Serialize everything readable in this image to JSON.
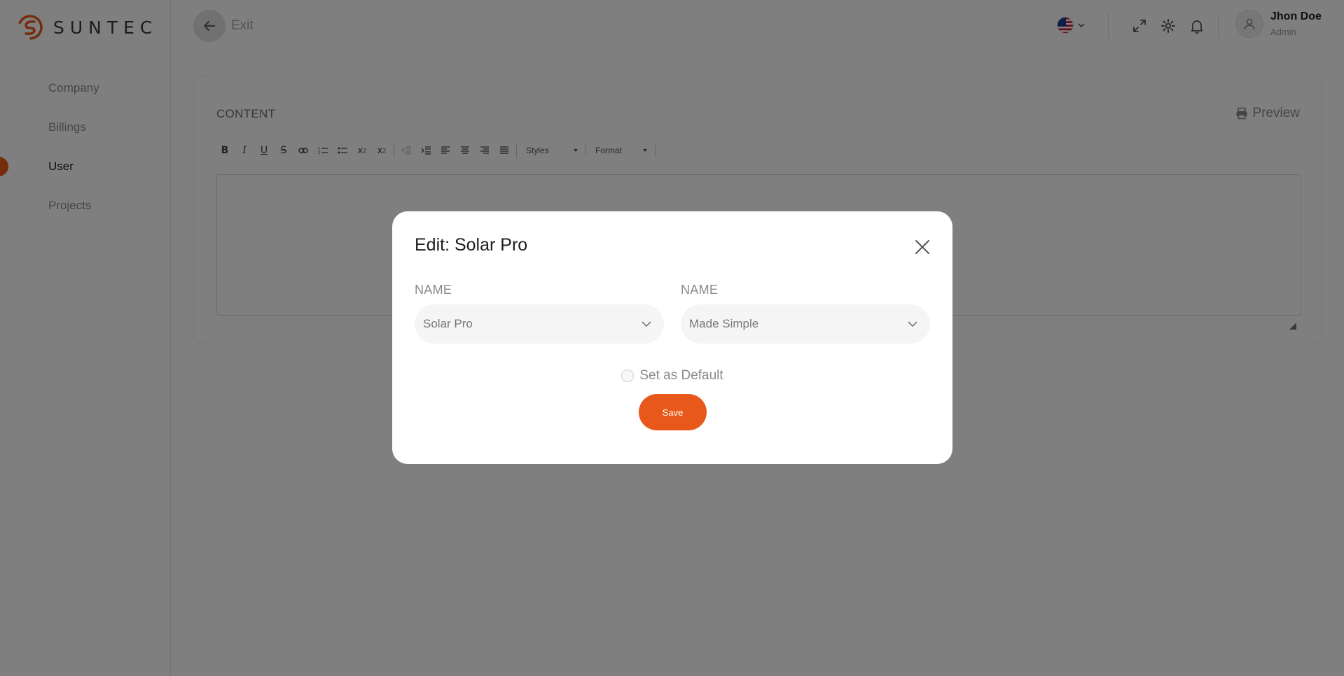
{
  "brand": {
    "name": "SUNTEC",
    "accent": "#e8581a"
  },
  "sidebar": {
    "items": [
      {
        "label": "Company",
        "active": false
      },
      {
        "label": "Billings",
        "active": false
      },
      {
        "label": "User",
        "active": true
      },
      {
        "label": "Projects",
        "active": false
      }
    ]
  },
  "header": {
    "exit_label": "Exit",
    "language_icon": "us-flag-icon",
    "icons": [
      "fullscreen-icon",
      "gear-icon",
      "bell-icon"
    ],
    "user": {
      "name": "Jhon Doe",
      "role": "Admin"
    }
  },
  "content": {
    "title": "CONTENT",
    "preview_label": "Preview",
    "toolbar": {
      "styles_label": "Styles",
      "format_label": "Format"
    }
  },
  "modal": {
    "title": "Edit: Solar Pro",
    "fields": [
      {
        "label": "NAME",
        "value": "Solar Pro"
      },
      {
        "label": "NAME",
        "value": "Made Simple"
      }
    ],
    "default_label": "Set as Default",
    "default_checked": false,
    "save_label": "Save"
  }
}
